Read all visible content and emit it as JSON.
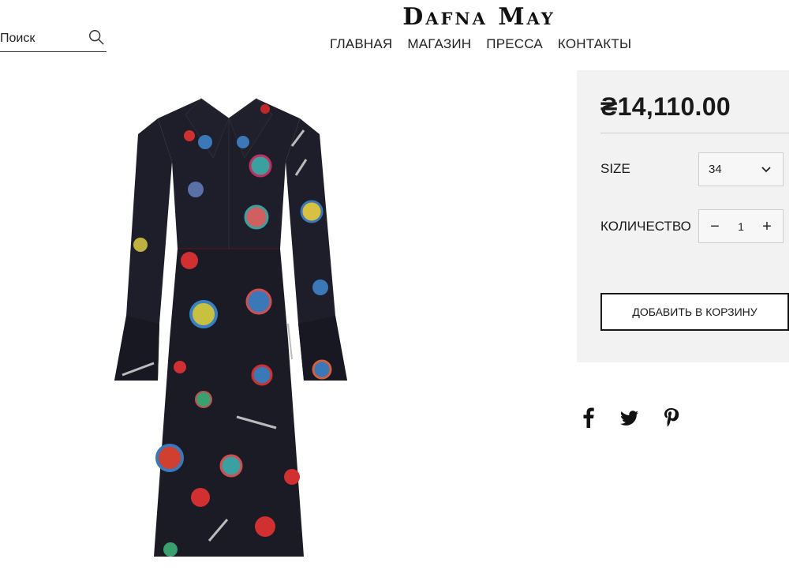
{
  "search": {
    "placeholder": "Поиск",
    "icon": "search-icon"
  },
  "header": {
    "brand": "Dafna May",
    "nav": [
      "ГЛАВНАЯ",
      "МАГАЗИН",
      "ПРЕССА",
      "КОНТАКТЫ"
    ]
  },
  "product": {
    "image": "dress-image",
    "price": "₴14,110.00",
    "size_label": "SIZE",
    "size_value": "34",
    "quantity_label": "КОЛИЧЕСТВО",
    "quantity_value": "1",
    "decrement": "−",
    "increment": "+",
    "add_to_cart": "ДОБАВИТЬ В КОРЗИНУ"
  },
  "share": {
    "icons": [
      "facebook-icon",
      "twitter-icon",
      "pinterest-icon"
    ]
  },
  "colors": {
    "panel_bg": "#f2f2f2",
    "dress": "#1e1e2a",
    "text": "#1a1a1a"
  }
}
